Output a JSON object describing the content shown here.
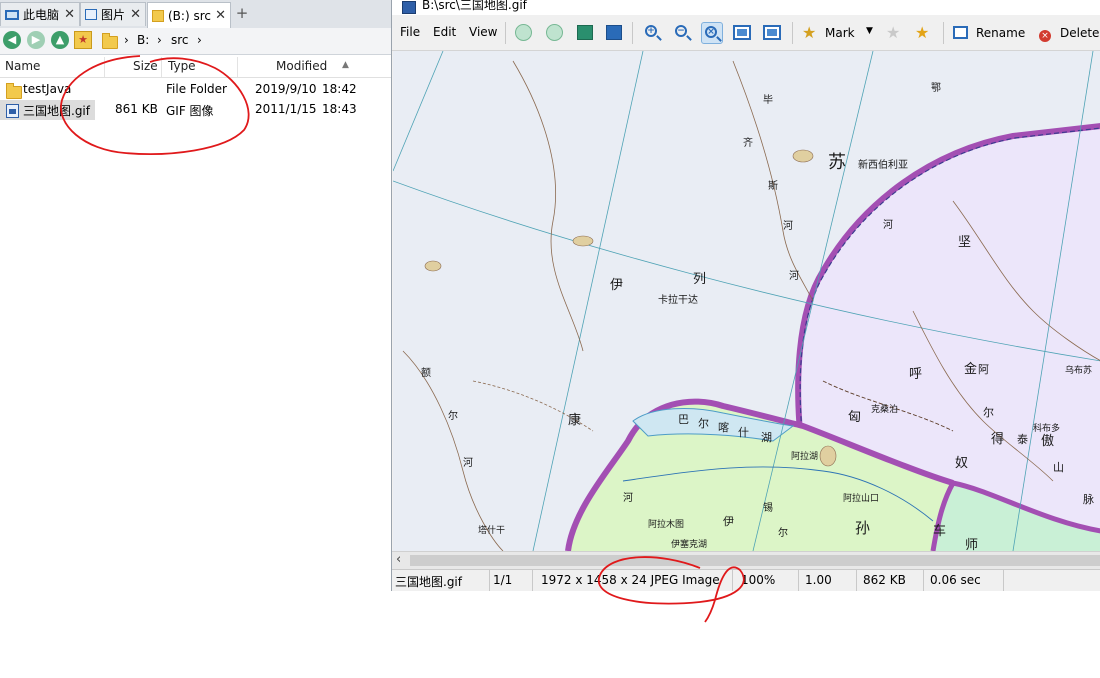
{
  "explorer": {
    "tabs": [
      {
        "label": "此电脑",
        "icon": "computer-icon"
      },
      {
        "label": "图片",
        "icon": "pictures-icon"
      },
      {
        "label": "(B:) src",
        "icon": "folder-icon"
      }
    ],
    "close_glyph": "✕",
    "new_tab_glyph": "+",
    "breadcrumb": [
      "B:",
      "src"
    ],
    "columns": {
      "name": "Name",
      "size": "Size",
      "type": "Type",
      "modified": "Modified"
    },
    "rows": [
      {
        "name": "testJava",
        "size": "",
        "type": "File Folder",
        "date": "2019/9/10",
        "time": "18:42"
      },
      {
        "name": "三国地图.gif",
        "size": "861 KB",
        "type": "GIF 图像",
        "date": "2011/1/15",
        "time": "18:43"
      }
    ]
  },
  "viewer": {
    "title": "B:\\src\\三国地图.gif",
    "menu": [
      "File",
      "Edit",
      "View"
    ],
    "toolbar": {
      "mark": "Mark",
      "rename": "Rename",
      "delete": "Delete"
    },
    "map_labels": [
      "苏",
      "新西伯利亚",
      "坚",
      "伊",
      "列",
      "卡拉干达",
      "呼",
      "金",
      "阿",
      "乌布苏",
      "克桑泊",
      "匈",
      "尔",
      "科布多",
      "得",
      "泰",
      "傲",
      "奴",
      "山",
      "脉",
      "康",
      "巴",
      "尔",
      "喀",
      "什",
      "湖",
      "阿拉湖",
      "阿拉山口",
      "孙",
      "车",
      "师",
      "阿拉木图",
      "伊",
      "伊塞克湖",
      "塔什干",
      "额",
      "尔",
      "齐",
      "斯",
      "河",
      "鄂",
      "毕",
      "河",
      "河",
      "河",
      "锡",
      "尔",
      "河"
    ],
    "status": {
      "filename": "三国地图.gif",
      "index": "1/1",
      "info": "1972 x 1458 x 24 JPEG Image",
      "zoom": "100%",
      "ratio": "1.00",
      "size": "862 KB",
      "time": "0.06 sec"
    }
  },
  "colors": {
    "annotation": "#e0191b",
    "accent": "#2a6bb8",
    "nav_green": "#3d9e6a"
  }
}
